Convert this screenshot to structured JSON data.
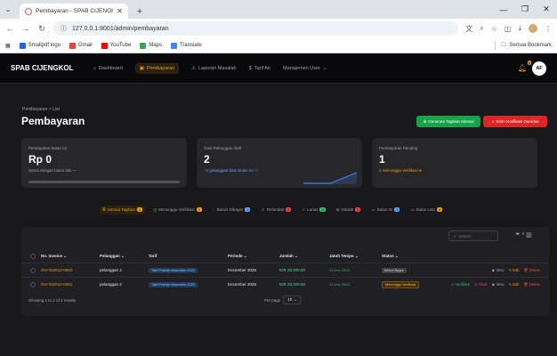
{
  "browser": {
    "tab_title": "Pembayaran - SPAB CIJENGKOL",
    "url_host": "127.0.0.1:8001",
    "url_path": "/admin/pembayaran",
    "bookmarks": [
      {
        "label": "Smallpdf logo",
        "color": "#2563eb"
      },
      {
        "label": "Gmail",
        "color": "#ea4335"
      },
      {
        "label": "YouTube",
        "color": "#ff0000"
      },
      {
        "label": "Maps",
        "color": "#34a853"
      },
      {
        "label": "Translate",
        "color": "#4285f4"
      }
    ],
    "all_bookmarks": "Semua Bookmark"
  },
  "app": {
    "brand": "SPAB CIJENGKOL",
    "nav": [
      {
        "label": "Dashboard",
        "icon": "home-icon",
        "active": false
      },
      {
        "label": "Pembayaran",
        "icon": "wallet-icon",
        "active": true
      },
      {
        "label": "Laporan Masalah",
        "icon": "alert-icon",
        "active": false
      },
      {
        "label": "Tarif Air",
        "icon": "dollar-icon",
        "active": false
      },
      {
        "label": "Manajemen User",
        "icon": "users-icon",
        "active": false
      }
    ],
    "notif_count": "1",
    "avatar_initials": "AF"
  },
  "page": {
    "breadcrumb": "Pembayaran  >  List",
    "title": "Pembayaran",
    "btn_generate": "Generate Tagihan Massal",
    "btn_overdue": "Kirim Notifikasi Overdue"
  },
  "stats": [
    {
      "label": "Pendapatan Bulan Ini",
      "value": "Rp 0",
      "sub": "Sama dengan bulan lalu  —",
      "tone": "gray"
    },
    {
      "label": "Total Pelanggan Aktif",
      "value": "2",
      "sub": "+2 pelanggan baru bulan ini",
      "tone": "blue"
    },
    {
      "label": "Pembayaran Pending",
      "value": "1",
      "sub": "1 menunggu verifikasi",
      "tone": "amber"
    }
  ],
  "filters": [
    {
      "label": "Semua Tagihan",
      "count": "2",
      "color": "#f59e0b",
      "active": true
    },
    {
      "label": "Menunggu Verifikasi",
      "count": "1",
      "color": "#f59e0b",
      "active": false
    },
    {
      "label": "Belum Dibayar",
      "count": "1",
      "color": "#60a5fa",
      "active": false
    },
    {
      "label": "Terlambat",
      "count": "0",
      "color": "#ef4444",
      "active": false
    },
    {
      "label": "Lunas",
      "count": "0",
      "color": "#22c55e",
      "active": false
    },
    {
      "label": "Ditolak",
      "count": "0",
      "color": "#ef4444",
      "active": false
    },
    {
      "label": "Bulan Ini",
      "count": "2",
      "color": "#60a5fa",
      "active": false
    },
    {
      "label": "Bulan Lalu",
      "count": "0",
      "color": "#f59e0b",
      "active": false
    }
  ],
  "table": {
    "search_placeholder": "Search",
    "filter_count": "0",
    "columns": [
      "No. Invoice",
      "Pelanggan",
      "Tarif",
      "Periode",
      "Jumlah",
      "Jatuh Tempo",
      "Status"
    ],
    "rows": [
      {
        "invoice": "INV-202512-0002",
        "pelanggan": "pelanggan 2",
        "tarif": "Tarif Periode desember 2025",
        "periode": "December 2025",
        "jumlah": "IDR 20,000.00",
        "jatuh_tempo": "31 Dec 2025",
        "status": "Belum Bayar",
        "actions": {
          "view": "View",
          "edit": "Edit",
          "delete": "Delete"
        }
      },
      {
        "invoice": "INV-202512-0001",
        "pelanggan": "pelanggan 2",
        "tarif": "Tarif Periode desember 2025",
        "periode": "December 2025",
        "jumlah": "IDR 20,000.00",
        "jatuh_tempo": "31 Dec 2025",
        "status": "Menunggu Verifikasi",
        "actions": {
          "verify": "Verifikasi",
          "reject": "Tolak",
          "view": "View",
          "edit": "Edit",
          "delete": "Delete"
        }
      }
    ],
    "footer_text": "Showing 1 to 2 of 2 results",
    "per_page_label": "Per page",
    "per_page_value": "10"
  }
}
